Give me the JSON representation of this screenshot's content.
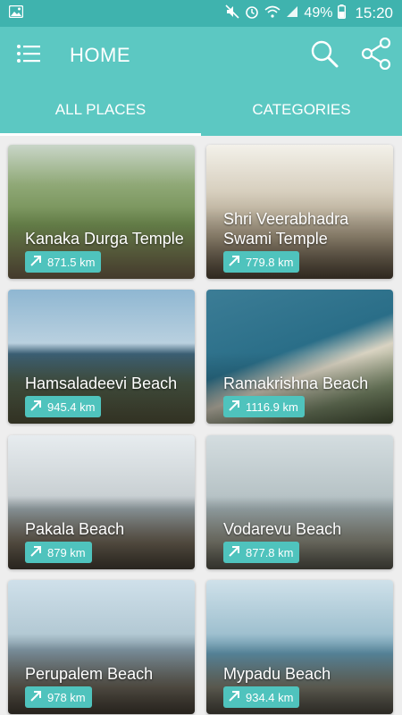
{
  "status_bar": {
    "battery": "49%",
    "time": "15:20"
  },
  "app_bar": {
    "title": "HOME"
  },
  "tabs": [
    {
      "label": "ALL PLACES",
      "active": true
    },
    {
      "label": "CATEGORIES",
      "active": false
    }
  ],
  "places": [
    {
      "name": "Kanaka Durga Temple",
      "distance": "871.5 km"
    },
    {
      "name": "Shri Veerabhadra Swami Temple",
      "distance": "779.8 km"
    },
    {
      "name": "Hamsaladeevi Beach",
      "distance": "945.4 km"
    },
    {
      "name": "Ramakrishna Beach",
      "distance": "1116.9 km"
    },
    {
      "name": "Pakala Beach",
      "distance": "879 km"
    },
    {
      "name": "Vodarevu Beach",
      "distance": "877.8 km"
    },
    {
      "name": "Perupalem Beach",
      "distance": "978 km"
    },
    {
      "name": "Mypadu Beach",
      "distance": "934.4 km"
    }
  ],
  "colors": {
    "status_bar": "#3fb3ae",
    "app_bar": "#5cc8c2",
    "distance_badge": "#4fc3bd"
  }
}
